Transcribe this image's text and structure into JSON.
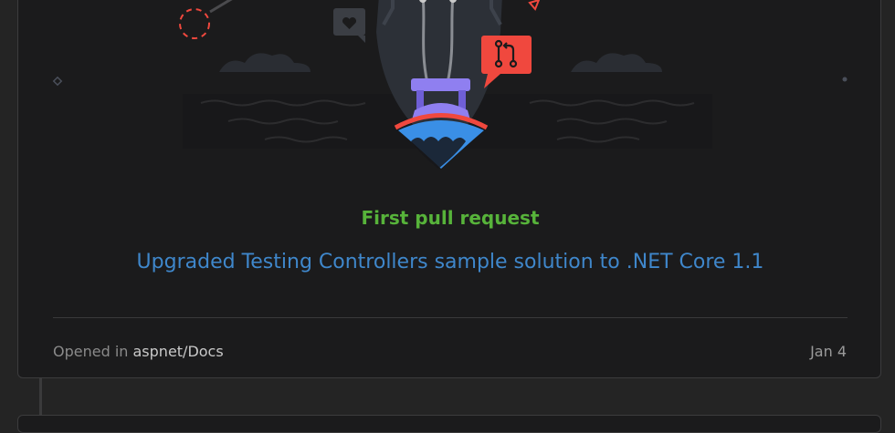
{
  "card": {
    "title": "First pull request",
    "pr_title": "Upgraded Testing Controllers sample solution to .NET Core 1.1",
    "opened_prefix": "Opened in",
    "repo": "aspnet/Docs",
    "date": "Jan 4"
  },
  "illustration": {
    "icons": [
      "heart-icon",
      "pull-request-icon",
      "boat-icon",
      "ship-icon"
    ]
  },
  "colors": {
    "title": "#57b33a",
    "link": "#3f87cb",
    "card_bg": "#1b1b1c",
    "page_bg": "#242424",
    "accent_red": "#f0483e",
    "boat_purple": "#8f7ff0",
    "boat_blue": "#3a8fe6"
  }
}
